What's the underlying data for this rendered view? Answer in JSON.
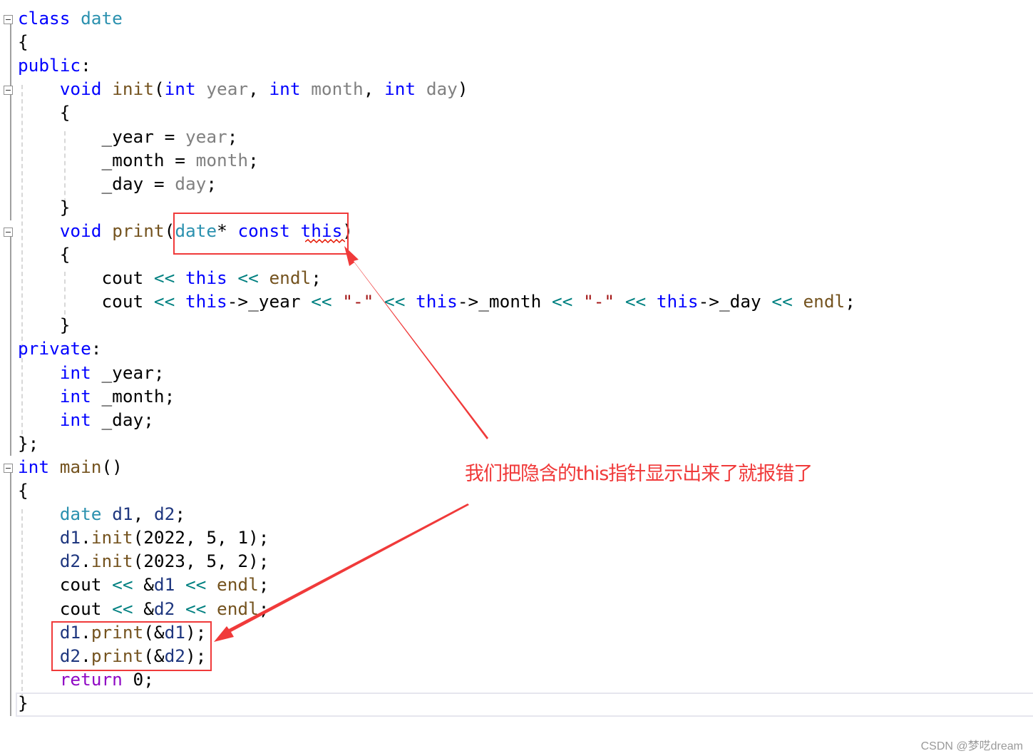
{
  "code": {
    "lines": [
      [
        [
          "class ",
          "kw"
        ],
        [
          "date",
          "ty"
        ]
      ],
      [
        [
          "{",
          "nm"
        ]
      ],
      [
        [
          "public",
          "kw"
        ],
        [
          ":",
          "nm"
        ]
      ],
      [
        [
          "    ",
          "nm"
        ],
        [
          "void ",
          "kw"
        ],
        [
          "init",
          "fn"
        ],
        [
          "(",
          "nm"
        ],
        [
          "int ",
          "kw"
        ],
        [
          "year",
          "pa"
        ],
        [
          ", ",
          "nm"
        ],
        [
          "int ",
          "kw"
        ],
        [
          "month",
          "pa"
        ],
        [
          ", ",
          "nm"
        ],
        [
          "int ",
          "kw"
        ],
        [
          "day",
          "pa"
        ],
        [
          ")",
          "nm"
        ]
      ],
      [
        [
          "    {",
          "nm"
        ]
      ],
      [
        [
          "        _year = ",
          "nm"
        ],
        [
          "year",
          "pa"
        ],
        [
          ";",
          "nm"
        ]
      ],
      [
        [
          "        _month = ",
          "nm"
        ],
        [
          "month",
          "pa"
        ],
        [
          ";",
          "nm"
        ]
      ],
      [
        [
          "        _day = ",
          "nm"
        ],
        [
          "day",
          "pa"
        ],
        [
          ";",
          "nm"
        ]
      ],
      [
        [
          "    }",
          "nm"
        ]
      ],
      [
        [
          "    ",
          "nm"
        ],
        [
          "void ",
          "kw"
        ],
        [
          "print",
          "fn"
        ],
        [
          "(",
          "nm"
        ],
        [
          "date",
          "ty"
        ],
        [
          "* ",
          "nm"
        ],
        [
          "const ",
          "kw"
        ],
        [
          "this",
          "kw"
        ],
        [
          ")",
          "nm"
        ]
      ],
      [
        [
          "    {",
          "nm"
        ]
      ],
      [
        [
          "        cout ",
          "nm"
        ],
        [
          "<< ",
          "op"
        ],
        [
          "this ",
          "kw"
        ],
        [
          "<< ",
          "op"
        ],
        [
          "endl",
          "fn"
        ],
        [
          ";",
          "nm"
        ]
      ],
      [
        [
          "        cout ",
          "nm"
        ],
        [
          "<< ",
          "op"
        ],
        [
          "this",
          "kw"
        ],
        [
          "->_year ",
          "nm"
        ],
        [
          "<< ",
          "op"
        ],
        [
          "\"-\" ",
          "st"
        ],
        [
          "<< ",
          "op"
        ],
        [
          "this",
          "kw"
        ],
        [
          "->_month ",
          "nm"
        ],
        [
          "<< ",
          "op"
        ],
        [
          "\"-\" ",
          "st"
        ],
        [
          "<< ",
          "op"
        ],
        [
          "this",
          "kw"
        ],
        [
          "->_day ",
          "nm"
        ],
        [
          "<< ",
          "op"
        ],
        [
          "endl",
          "fn"
        ],
        [
          ";",
          "nm"
        ]
      ],
      [
        [
          "    }",
          "nm"
        ]
      ],
      [
        [
          "private",
          "kw"
        ],
        [
          ":",
          "nm"
        ]
      ],
      [
        [
          "    ",
          "nm"
        ],
        [
          "int ",
          "kw"
        ],
        [
          "_year;",
          "nm"
        ]
      ],
      [
        [
          "    ",
          "nm"
        ],
        [
          "int ",
          "kw"
        ],
        [
          "_month;",
          "nm"
        ]
      ],
      [
        [
          "    ",
          "nm"
        ],
        [
          "int ",
          "kw"
        ],
        [
          "_day;",
          "nm"
        ]
      ],
      [
        [
          "};",
          "nm"
        ]
      ],
      [
        [
          "int ",
          "kw"
        ],
        [
          "main",
          "fn"
        ],
        [
          "()",
          "nm"
        ]
      ],
      [
        [
          "{",
          "nm"
        ]
      ],
      [
        [
          "    ",
          "nm"
        ],
        [
          "date ",
          "ty"
        ],
        [
          "d1",
          "lv"
        ],
        [
          ", ",
          "nm"
        ],
        [
          "d2",
          "lv"
        ],
        [
          ";",
          "nm"
        ]
      ],
      [
        [
          "    ",
          "nm"
        ],
        [
          "d1",
          "lv"
        ],
        [
          ".",
          "nm"
        ],
        [
          "init",
          "fn"
        ],
        [
          "(2022, 5, 1);",
          "nm"
        ]
      ],
      [
        [
          "    ",
          "nm"
        ],
        [
          "d2",
          "lv"
        ],
        [
          ".",
          "nm"
        ],
        [
          "init",
          "fn"
        ],
        [
          "(2023, 5, 2);",
          "nm"
        ]
      ],
      [
        [
          "    cout ",
          "nm"
        ],
        [
          "<< ",
          "op"
        ],
        [
          "&",
          "nm"
        ],
        [
          "d1 ",
          "lv"
        ],
        [
          "<< ",
          "op"
        ],
        [
          "endl",
          "fn"
        ],
        [
          ";",
          "nm"
        ]
      ],
      [
        [
          "    cout ",
          "nm"
        ],
        [
          "<< ",
          "op"
        ],
        [
          "&",
          "nm"
        ],
        [
          "d2 ",
          "lv"
        ],
        [
          "<< ",
          "op"
        ],
        [
          "endl",
          "fn"
        ],
        [
          ";",
          "nm"
        ]
      ],
      [
        [
          "    ",
          "nm"
        ],
        [
          "d1",
          "lv"
        ],
        [
          ".",
          "nm"
        ],
        [
          "print",
          "fn"
        ],
        [
          "(&",
          "nm"
        ],
        [
          "d1",
          "lv"
        ],
        [
          ");",
          "nm"
        ]
      ],
      [
        [
          "    ",
          "nm"
        ],
        [
          "d2",
          "lv"
        ],
        [
          ".",
          "nm"
        ],
        [
          "print",
          "fn"
        ],
        [
          "(&",
          "nm"
        ],
        [
          "d2",
          "lv"
        ],
        [
          ");",
          "nm"
        ]
      ],
      [
        [
          "    ",
          "nm"
        ],
        [
          "return ",
          "rt"
        ],
        [
          "0;",
          "nm"
        ]
      ],
      [
        [
          "}",
          "nm"
        ]
      ]
    ]
  },
  "annotation": {
    "note": "我们把隐含的this指针显示出来了就报错了",
    "color": "#f03a3a"
  },
  "watermark": "CSDN @梦呓dream"
}
